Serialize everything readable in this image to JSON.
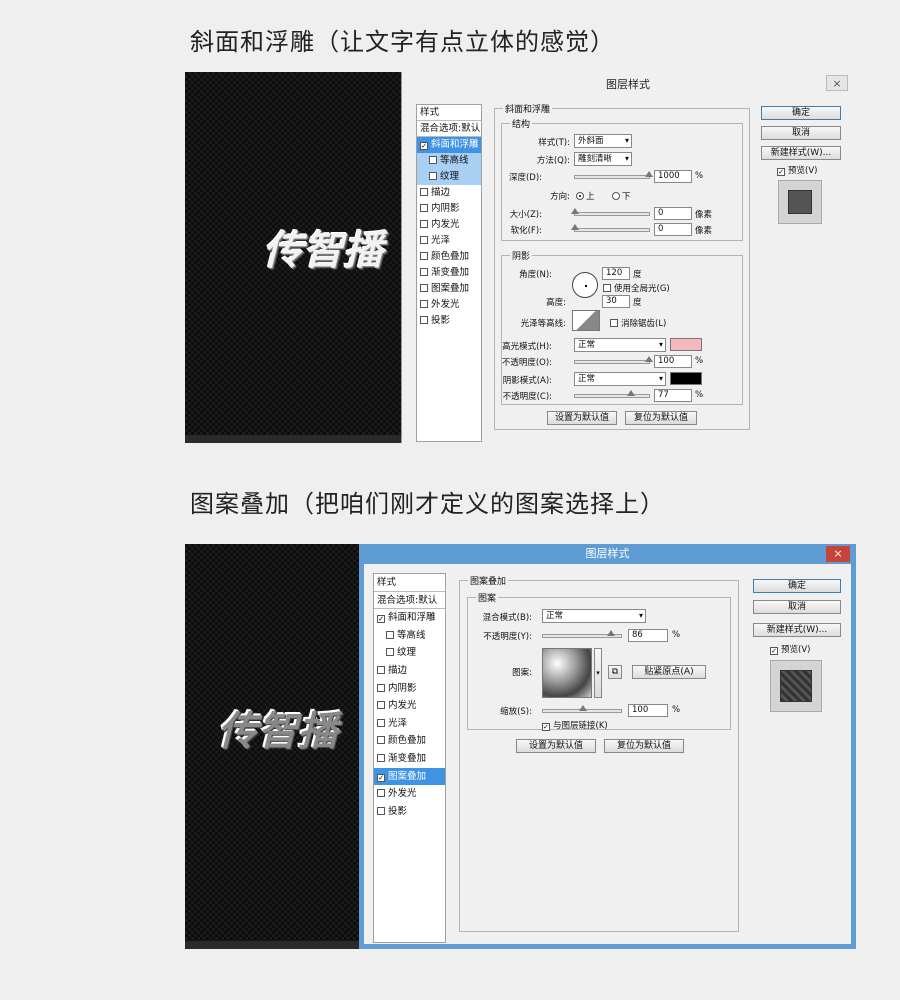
{
  "headings": {
    "h1": "斜面和浮雕（让文字有点立体的感觉）",
    "h2": "图案叠加（把咱们刚才定义的图案选择上）"
  },
  "canvas_text": "传智播",
  "dialog1": {
    "title": "图层样式",
    "close": "×",
    "style_list": {
      "header": "样式",
      "blend": "混合选项:默认",
      "items": [
        {
          "label": "斜面和浮雕",
          "checked": true
        },
        {
          "label": "等高线",
          "checked": false
        },
        {
          "label": "纹理",
          "checked": false
        },
        {
          "label": "描边",
          "checked": false
        },
        {
          "label": "内阴影",
          "checked": false
        },
        {
          "label": "内发光",
          "checked": false
        },
        {
          "label": "光泽",
          "checked": false
        },
        {
          "label": "颜色叠加",
          "checked": false
        },
        {
          "label": "渐变叠加",
          "checked": false
        },
        {
          "label": "图案叠加",
          "checked": false
        },
        {
          "label": "外发光",
          "checked": false
        },
        {
          "label": "投影",
          "checked": false
        }
      ]
    },
    "panel_title": "斜面和浮雕",
    "structure": {
      "title": "结构",
      "style_label": "样式(T):",
      "style_value": "外斜面",
      "method_label": "方法(Q):",
      "method_value": "雕刻清晰",
      "depth_label": "深度(D):",
      "depth_value": "1000",
      "depth_unit": "%",
      "direction_label": "方向:",
      "dir_up": "上",
      "dir_down": "下",
      "size_label": "大小(Z):",
      "size_value": "0",
      "size_unit": "像素",
      "soften_label": "软化(F):",
      "soften_value": "0",
      "soften_unit": "像素"
    },
    "shading": {
      "title": "阴影",
      "angle_label": "角度(N):",
      "angle_value": "120",
      "angle_unit": "度",
      "global_light": "使用全局光(G)",
      "altitude_label": "高度:",
      "altitude_value": "30",
      "altitude_unit": "度",
      "gloss_label": "光泽等高线:",
      "antialias": "消除锯齿(L)",
      "highlight_label": "高光模式(H):",
      "highlight_value": "正常",
      "highlight_color": "#f4b9bc",
      "opacity1_label": "不透明度(O):",
      "opacity1_value": "100",
      "opacity1_unit": "%",
      "shadow_label": "阴影模式(A):",
      "shadow_value": "正常",
      "shadow_color": "#000000",
      "opacity2_label": "不透明度(C):",
      "opacity2_value": "77",
      "opacity2_unit": "%"
    },
    "btn_set_default": "设置为默认值",
    "btn_reset_default": "复位为默认值",
    "btn_ok": "确定",
    "btn_cancel": "取消",
    "btn_new_style": "新建样式(W)...",
    "preview_label": "预览(V)"
  },
  "dialog2": {
    "title": "图层样式",
    "close": "×",
    "style_list": {
      "header": "样式",
      "blend": "混合选项:默认",
      "items": [
        {
          "label": "斜面和浮雕",
          "checked": true
        },
        {
          "label": "等高线",
          "checked": false
        },
        {
          "label": "纹理",
          "checked": false
        },
        {
          "label": "描边",
          "checked": false
        },
        {
          "label": "内阴影",
          "checked": false
        },
        {
          "label": "内发光",
          "checked": false
        },
        {
          "label": "光泽",
          "checked": false
        },
        {
          "label": "颜色叠加",
          "checked": false
        },
        {
          "label": "渐变叠加",
          "checked": false
        },
        {
          "label": "图案叠加",
          "checked": true
        },
        {
          "label": "外发光",
          "checked": false
        },
        {
          "label": "投影",
          "checked": false
        }
      ]
    },
    "panel_title": "图案叠加",
    "pattern": {
      "title": "图案",
      "blend_label": "混合模式(B):",
      "blend_value": "正常",
      "opacity_label": "不透明度(Y):",
      "opacity_value": "86",
      "opacity_unit": "%",
      "pattern_label": "图案:",
      "snap_origin": "贴紧原点(A)",
      "scale_label": "缩放(S):",
      "scale_value": "100",
      "scale_unit": "%",
      "link_layer": "与图层链接(K)"
    },
    "btn_set_default": "设置为默认值",
    "btn_reset_default": "复位为默认值",
    "btn_ok": "确定",
    "btn_cancel": "取消",
    "btn_new_style": "新建样式(W)...",
    "preview_label": "预览(V)"
  }
}
